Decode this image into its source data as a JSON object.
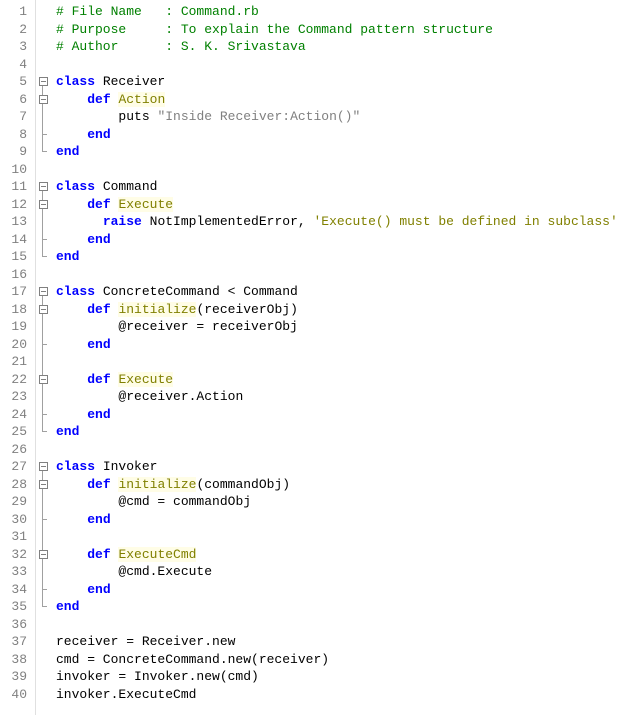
{
  "lines": [
    {
      "n": 1,
      "fold": "",
      "tokens": [
        [
          "c-comment",
          "# File Name   : Command.rb"
        ]
      ]
    },
    {
      "n": 2,
      "fold": "",
      "tokens": [
        [
          "c-comment",
          "# Purpose     : To explain the Command pattern structure"
        ]
      ]
    },
    {
      "n": 3,
      "fold": "",
      "tokens": [
        [
          "c-comment",
          "# Author      : S. K. Srivastava"
        ]
      ]
    },
    {
      "n": 4,
      "fold": "",
      "tokens": [
        [
          "",
          ""
        ]
      ]
    },
    {
      "n": 5,
      "fold": "open",
      "tokens": [
        [
          "c-kw",
          "class"
        ],
        [
          "",
          " "
        ],
        [
          "c-cls",
          "Receiver"
        ]
      ]
    },
    {
      "n": 6,
      "fold": "open-nested",
      "tokens": [
        [
          "",
          "    "
        ],
        [
          "c-kw",
          "def"
        ],
        [
          "",
          " "
        ],
        [
          "c-def",
          "Action"
        ]
      ]
    },
    {
      "n": 7,
      "fold": "line2",
      "tokens": [
        [
          "",
          "        "
        ],
        [
          "c-id",
          "puts"
        ],
        [
          "",
          " "
        ],
        [
          "c-str",
          "\"Inside Receiver:Action()\""
        ]
      ]
    },
    {
      "n": 8,
      "fold": "close-nested",
      "tokens": [
        [
          "",
          "    "
        ],
        [
          "c-kw",
          "end"
        ]
      ]
    },
    {
      "n": 9,
      "fold": "close",
      "tokens": [
        [
          "c-kw",
          "end"
        ]
      ]
    },
    {
      "n": 10,
      "fold": "",
      "tokens": [
        [
          "",
          ""
        ]
      ]
    },
    {
      "n": 11,
      "fold": "open",
      "tokens": [
        [
          "c-kw",
          "class"
        ],
        [
          "",
          " "
        ],
        [
          "c-cls",
          "Command"
        ]
      ]
    },
    {
      "n": 12,
      "fold": "open-nested",
      "tokens": [
        [
          "",
          "    "
        ],
        [
          "c-kw",
          "def"
        ],
        [
          "",
          " "
        ],
        [
          "c-def",
          "Execute"
        ]
      ]
    },
    {
      "n": 13,
      "fold": "line2",
      "tokens": [
        [
          "",
          "      "
        ],
        [
          "c-kw",
          "raise"
        ],
        [
          "",
          " "
        ],
        [
          "c-id",
          "NotImplementedError"
        ],
        [
          "c-id",
          ","
        ],
        [
          "",
          " "
        ],
        [
          "c-str2",
          "'Execute() must be defined in subclass'"
        ]
      ]
    },
    {
      "n": 14,
      "fold": "close-nested",
      "tokens": [
        [
          "",
          "    "
        ],
        [
          "c-kw",
          "end"
        ]
      ]
    },
    {
      "n": 15,
      "fold": "close",
      "tokens": [
        [
          "c-kw",
          "end"
        ]
      ]
    },
    {
      "n": 16,
      "fold": "",
      "tokens": [
        [
          "",
          ""
        ]
      ]
    },
    {
      "n": 17,
      "fold": "open",
      "tokens": [
        [
          "c-kw",
          "class"
        ],
        [
          "",
          " "
        ],
        [
          "c-cls",
          "ConcreteCommand < Command"
        ]
      ]
    },
    {
      "n": 18,
      "fold": "open-nested",
      "tokens": [
        [
          "",
          "    "
        ],
        [
          "c-kw",
          "def"
        ],
        [
          "",
          " "
        ],
        [
          "c-def",
          "initialize"
        ],
        [
          "c-id",
          "(receiverObj)"
        ]
      ]
    },
    {
      "n": 19,
      "fold": "line2",
      "tokens": [
        [
          "",
          "        "
        ],
        [
          "c-id",
          "@receiver = receiverObj"
        ]
      ]
    },
    {
      "n": 20,
      "fold": "close-nested",
      "tokens": [
        [
          "",
          "    "
        ],
        [
          "c-kw",
          "end"
        ]
      ]
    },
    {
      "n": 21,
      "fold": "line",
      "tokens": [
        [
          "",
          ""
        ]
      ]
    },
    {
      "n": 22,
      "fold": "open-nested",
      "tokens": [
        [
          "",
          "    "
        ],
        [
          "c-kw",
          "def"
        ],
        [
          "",
          " "
        ],
        [
          "c-def",
          "Execute"
        ]
      ]
    },
    {
      "n": 23,
      "fold": "line2",
      "tokens": [
        [
          "",
          "        "
        ],
        [
          "c-id",
          "@receiver.Action"
        ]
      ]
    },
    {
      "n": 24,
      "fold": "close-nested",
      "tokens": [
        [
          "",
          "    "
        ],
        [
          "c-kw",
          "end"
        ]
      ]
    },
    {
      "n": 25,
      "fold": "close",
      "tokens": [
        [
          "c-kw",
          "end"
        ]
      ]
    },
    {
      "n": 26,
      "fold": "",
      "tokens": [
        [
          "",
          ""
        ]
      ]
    },
    {
      "n": 27,
      "fold": "open",
      "tokens": [
        [
          "c-kw",
          "class"
        ],
        [
          "",
          " "
        ],
        [
          "c-cls",
          "Invoker"
        ]
      ]
    },
    {
      "n": 28,
      "fold": "open-nested",
      "tokens": [
        [
          "",
          "    "
        ],
        [
          "c-kw",
          "def"
        ],
        [
          "",
          " "
        ],
        [
          "c-def",
          "initialize"
        ],
        [
          "c-id",
          "(commandObj)"
        ]
      ]
    },
    {
      "n": 29,
      "fold": "line2",
      "tokens": [
        [
          "",
          "        "
        ],
        [
          "c-id",
          "@cmd = commandObj"
        ]
      ]
    },
    {
      "n": 30,
      "fold": "close-nested",
      "tokens": [
        [
          "",
          "    "
        ],
        [
          "c-kw",
          "end"
        ]
      ]
    },
    {
      "n": 31,
      "fold": "line",
      "tokens": [
        [
          "",
          ""
        ]
      ]
    },
    {
      "n": 32,
      "fold": "open-nested",
      "tokens": [
        [
          "",
          "    "
        ],
        [
          "c-kw",
          "def"
        ],
        [
          "",
          " "
        ],
        [
          "c-def",
          "ExecuteCmd"
        ]
      ]
    },
    {
      "n": 33,
      "fold": "line2",
      "tokens": [
        [
          "",
          "        "
        ],
        [
          "c-id",
          "@cmd.Execute"
        ]
      ]
    },
    {
      "n": 34,
      "fold": "close-nested",
      "tokens": [
        [
          "",
          "    "
        ],
        [
          "c-kw",
          "end"
        ]
      ]
    },
    {
      "n": 35,
      "fold": "close",
      "tokens": [
        [
          "c-kw",
          "end"
        ]
      ]
    },
    {
      "n": 36,
      "fold": "",
      "tokens": [
        [
          "",
          ""
        ]
      ]
    },
    {
      "n": 37,
      "fold": "",
      "tokens": [
        [
          "c-id",
          "receiver = Receiver.new"
        ]
      ]
    },
    {
      "n": 38,
      "fold": "",
      "tokens": [
        [
          "c-id",
          "cmd = ConcreteCommand.new(receiver)"
        ]
      ]
    },
    {
      "n": 39,
      "fold": "",
      "tokens": [
        [
          "c-id",
          "invoker = Invoker.new(cmd)"
        ]
      ]
    },
    {
      "n": 40,
      "fold": "",
      "tokens": [
        [
          "c-id",
          "invoker.ExecuteCmd"
        ]
      ]
    }
  ]
}
